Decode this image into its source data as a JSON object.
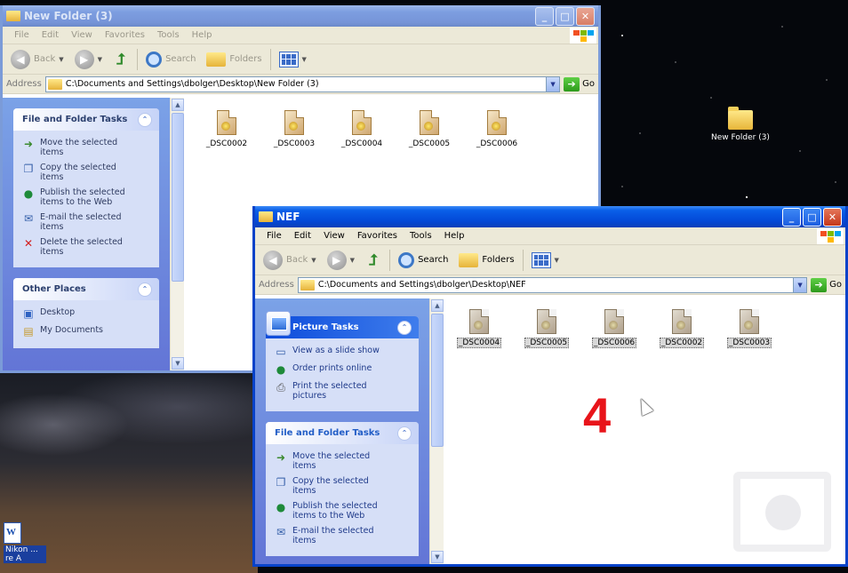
{
  "desktop": {
    "folder_icon_label": "New Folder (3)",
    "doc_icon_label": "Nikon ... re A"
  },
  "window_back": {
    "title": "New Folder (3)",
    "menu": [
      "File",
      "Edit",
      "View",
      "Favorites",
      "Tools",
      "Help"
    ],
    "toolbar": {
      "back": "Back",
      "search": "Search",
      "folders": "Folders"
    },
    "address_label": "Address",
    "address_value": "C:\\Documents and Settings\\dbolger\\Desktop\\New Folder (3)",
    "go_label": "Go",
    "file_tasks": {
      "title": "File and Folder Tasks",
      "items": [
        "Move the selected items",
        "Copy the selected items",
        "Publish the selected items to the Web",
        "E-mail the selected items",
        "Delete the selected items"
      ]
    },
    "other_places": {
      "title": "Other Places",
      "items": [
        "Desktop",
        "My Documents"
      ]
    },
    "files": [
      "_DSC0002",
      "_DSC0003",
      "_DSC0004",
      "_DSC0005",
      "_DSC0006"
    ]
  },
  "window_front": {
    "title": "NEF",
    "menu": [
      "File",
      "Edit",
      "View",
      "Favorites",
      "Tools",
      "Help"
    ],
    "toolbar": {
      "back": "Back",
      "search": "Search",
      "folders": "Folders"
    },
    "address_label": "Address",
    "address_value": "C:\\Documents and Settings\\dbolger\\Desktop\\NEF",
    "go_label": "Go",
    "picture_tasks": {
      "title": "Picture Tasks",
      "items": [
        "View as a slide show",
        "Order prints online",
        "Print the selected pictures"
      ]
    },
    "file_tasks": {
      "title": "File and Folder Tasks",
      "items": [
        "Move the selected items",
        "Copy the selected items",
        "Publish the selected items to the Web",
        "E-mail the selected items"
      ]
    },
    "files": [
      "_DSC0004",
      "_DSC0005",
      "_DSC0006",
      "_DSC0002",
      "_DSC0003"
    ]
  },
  "annotation": "4"
}
